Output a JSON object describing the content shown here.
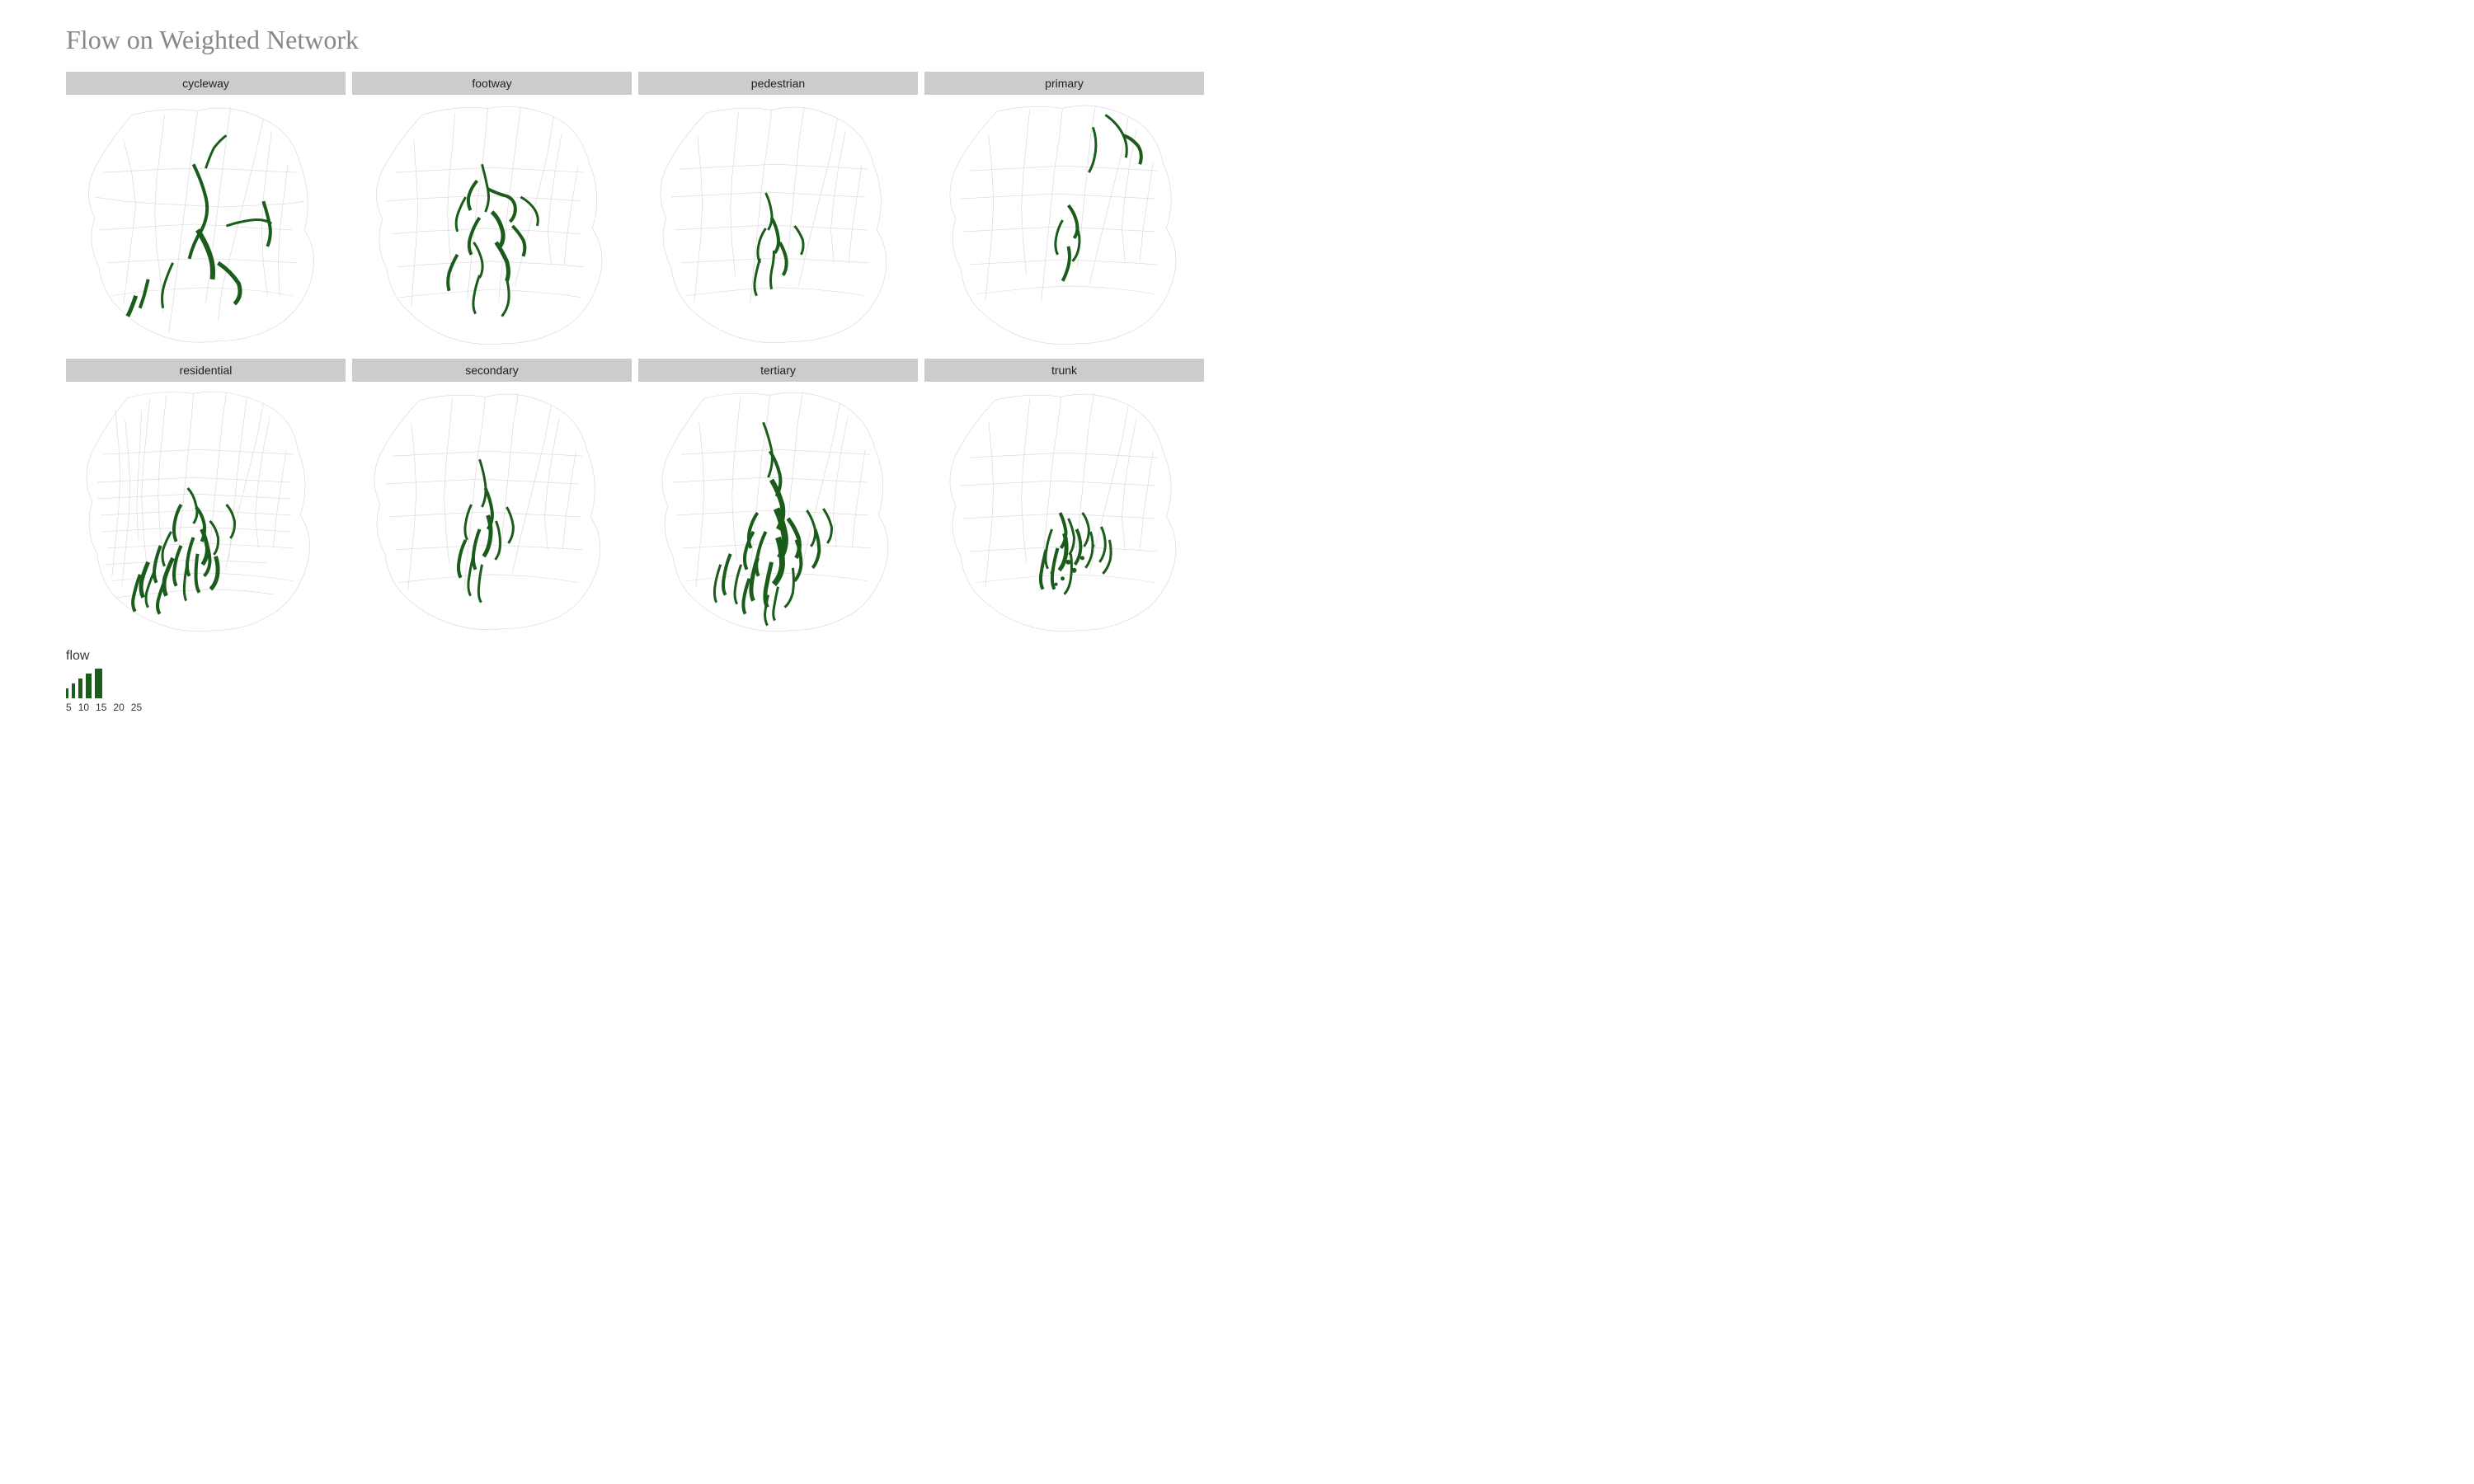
{
  "title": "Flow on Weighted Network",
  "row1": {
    "labels": [
      "cycleway",
      "footway",
      "pedestrian",
      "primary"
    ]
  },
  "row2": {
    "labels": [
      "residential",
      "secondary",
      "tertiary",
      "trunk"
    ]
  },
  "legend": {
    "title": "flow",
    "items": [
      {
        "value": "5",
        "height": 12,
        "width": 3
      },
      {
        "value": "10",
        "height": 18,
        "width": 4
      },
      {
        "value": "15",
        "height": 24,
        "width": 5
      },
      {
        "value": "20",
        "height": 30,
        "width": 7
      },
      {
        "value": "25",
        "height": 36,
        "width": 9
      }
    ]
  }
}
